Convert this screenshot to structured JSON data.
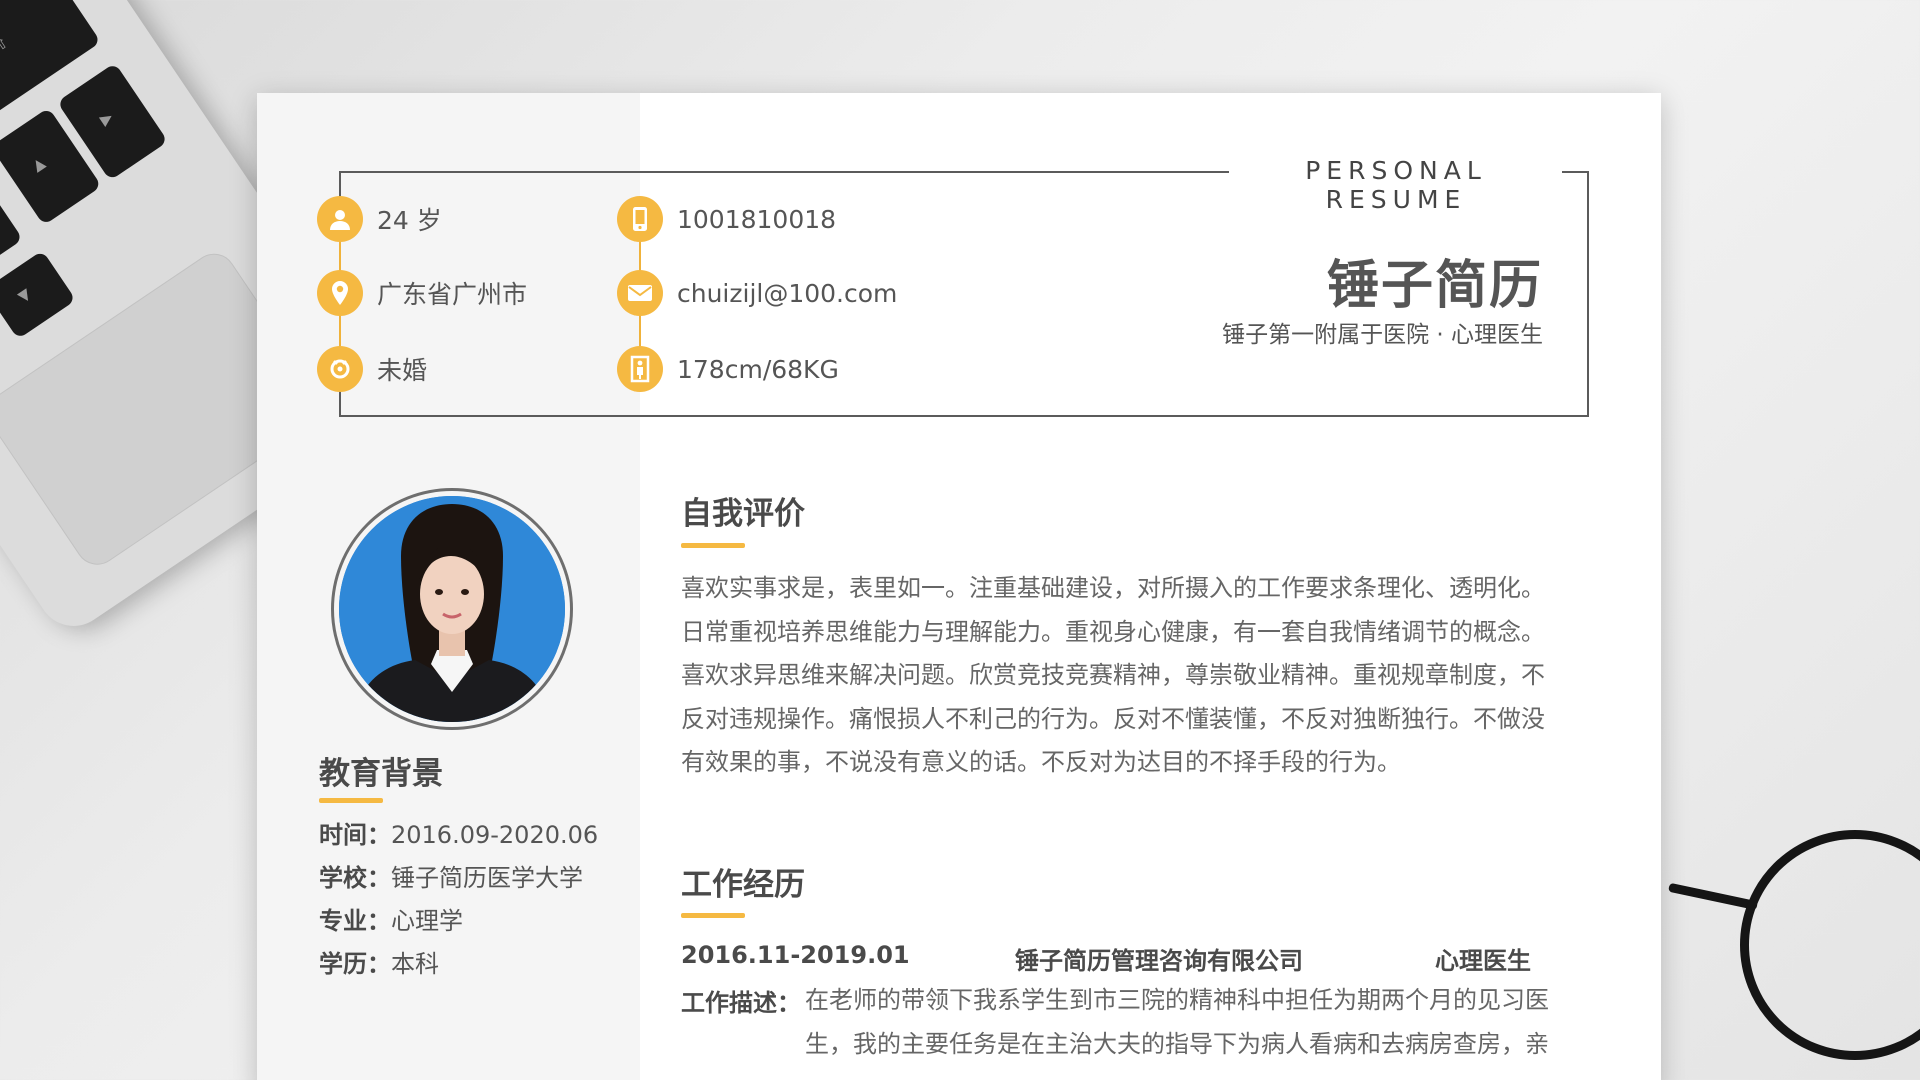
{
  "header": {
    "brand_tag": "PERSONAL RESUME",
    "name": "锤子简历",
    "subtitle": "锤子第一附属于医院 · 心理医生"
  },
  "personal_info": [
    {
      "icon": "user-icon",
      "value": "24 岁"
    },
    {
      "icon": "location-pin-icon",
      "value": "广东省广州市"
    },
    {
      "icon": "marital-status-icon",
      "value": "未婚"
    },
    {
      "icon": "phone-icon",
      "value": "1001810018"
    },
    {
      "icon": "mail-icon",
      "value": "chuizijl@100.com"
    },
    {
      "icon": "height-icon",
      "value": "178cm/68KG"
    }
  ],
  "education": {
    "title": "教育背景",
    "rows": [
      {
        "label": "时间：",
        "value": "2016.09-2020.06"
      },
      {
        "label": "学校：",
        "value": "锤子简历医学大学"
      },
      {
        "label": "专业：",
        "value": "心理学"
      },
      {
        "label": "学历：",
        "value": "本科"
      }
    ]
  },
  "self_evaluation": {
    "title": "自我评价",
    "lines": [
      "喜欢实事求是，表里如一。注重基础建设，对所摄入的工作要求条理化、透明化。",
      "日常重视培养思维能力与理解能力。重视身心健康，有一套自我情绪调节的概念。",
      "喜欢求异思维来解决问题。欣赏竞技竞赛精神，尊崇敬业精神。重视规章制度，不",
      "反对违规操作。痛恨损人不利己的行为。反对不懂装懂，不反对独断独行。不做没",
      "有效果的事，不说没有意义的话。不反对为达目的不择手段的行为。"
    ]
  },
  "work_experience": {
    "title": "工作经历",
    "jobs": [
      {
        "period": "2016.11-2019.01",
        "company": "锤子简历管理咨询有限公司",
        "position": "心理医生",
        "desc_label": "工作描述：",
        "desc_lines": [
          "在老师的带领下我系学生到市三院的精神科中担任为期两个月的见习医",
          "生，我的主要任务是在主治大夫的指导下为病人看病和去病房查房，亲"
        ]
      }
    ]
  },
  "colors": {
    "accent": "#f5b942",
    "frame": "#5b5b5b",
    "text": "#555555",
    "sidebar_bg": "#f5f5f5"
  }
}
